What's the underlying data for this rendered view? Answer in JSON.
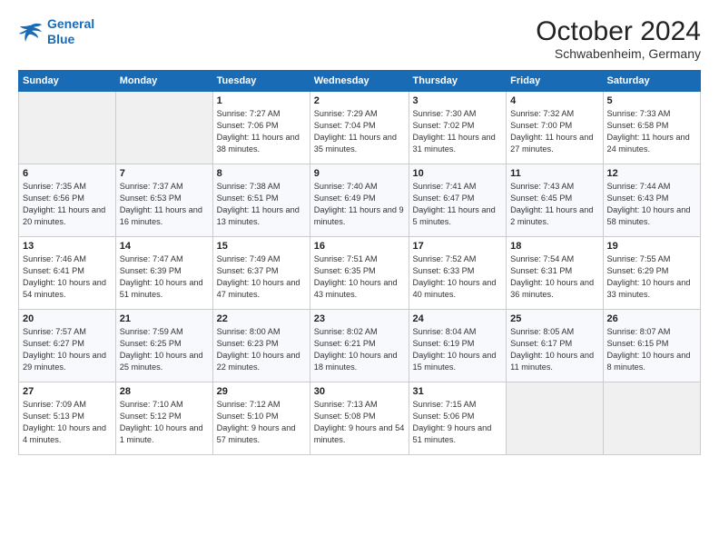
{
  "header": {
    "logo": {
      "line1": "General",
      "line2": "Blue"
    },
    "title": "October 2024",
    "location": "Schwabenheim, Germany"
  },
  "weekdays": [
    "Sunday",
    "Monday",
    "Tuesday",
    "Wednesday",
    "Thursday",
    "Friday",
    "Saturday"
  ],
  "weeks": [
    [
      {
        "day": "",
        "sunrise": "",
        "sunset": "",
        "daylight": "",
        "empty": true
      },
      {
        "day": "",
        "sunrise": "",
        "sunset": "",
        "daylight": "",
        "empty": true
      },
      {
        "day": "1",
        "sunrise": "Sunrise: 7:27 AM",
        "sunset": "Sunset: 7:06 PM",
        "daylight": "Daylight: 11 hours and 38 minutes."
      },
      {
        "day": "2",
        "sunrise": "Sunrise: 7:29 AM",
        "sunset": "Sunset: 7:04 PM",
        "daylight": "Daylight: 11 hours and 35 minutes."
      },
      {
        "day": "3",
        "sunrise": "Sunrise: 7:30 AM",
        "sunset": "Sunset: 7:02 PM",
        "daylight": "Daylight: 11 hours and 31 minutes."
      },
      {
        "day": "4",
        "sunrise": "Sunrise: 7:32 AM",
        "sunset": "Sunset: 7:00 PM",
        "daylight": "Daylight: 11 hours and 27 minutes."
      },
      {
        "day": "5",
        "sunrise": "Sunrise: 7:33 AM",
        "sunset": "Sunset: 6:58 PM",
        "daylight": "Daylight: 11 hours and 24 minutes."
      }
    ],
    [
      {
        "day": "6",
        "sunrise": "Sunrise: 7:35 AM",
        "sunset": "Sunset: 6:56 PM",
        "daylight": "Daylight: 11 hours and 20 minutes."
      },
      {
        "day": "7",
        "sunrise": "Sunrise: 7:37 AM",
        "sunset": "Sunset: 6:53 PM",
        "daylight": "Daylight: 11 hours and 16 minutes."
      },
      {
        "day": "8",
        "sunrise": "Sunrise: 7:38 AM",
        "sunset": "Sunset: 6:51 PM",
        "daylight": "Daylight: 11 hours and 13 minutes."
      },
      {
        "day": "9",
        "sunrise": "Sunrise: 7:40 AM",
        "sunset": "Sunset: 6:49 PM",
        "daylight": "Daylight: 11 hours and 9 minutes."
      },
      {
        "day": "10",
        "sunrise": "Sunrise: 7:41 AM",
        "sunset": "Sunset: 6:47 PM",
        "daylight": "Daylight: 11 hours and 5 minutes."
      },
      {
        "day": "11",
        "sunrise": "Sunrise: 7:43 AM",
        "sunset": "Sunset: 6:45 PM",
        "daylight": "Daylight: 11 hours and 2 minutes."
      },
      {
        "day": "12",
        "sunrise": "Sunrise: 7:44 AM",
        "sunset": "Sunset: 6:43 PM",
        "daylight": "Daylight: 10 hours and 58 minutes."
      }
    ],
    [
      {
        "day": "13",
        "sunrise": "Sunrise: 7:46 AM",
        "sunset": "Sunset: 6:41 PM",
        "daylight": "Daylight: 10 hours and 54 minutes."
      },
      {
        "day": "14",
        "sunrise": "Sunrise: 7:47 AM",
        "sunset": "Sunset: 6:39 PM",
        "daylight": "Daylight: 10 hours and 51 minutes."
      },
      {
        "day": "15",
        "sunrise": "Sunrise: 7:49 AM",
        "sunset": "Sunset: 6:37 PM",
        "daylight": "Daylight: 10 hours and 47 minutes."
      },
      {
        "day": "16",
        "sunrise": "Sunrise: 7:51 AM",
        "sunset": "Sunset: 6:35 PM",
        "daylight": "Daylight: 10 hours and 43 minutes."
      },
      {
        "day": "17",
        "sunrise": "Sunrise: 7:52 AM",
        "sunset": "Sunset: 6:33 PM",
        "daylight": "Daylight: 10 hours and 40 minutes."
      },
      {
        "day": "18",
        "sunrise": "Sunrise: 7:54 AM",
        "sunset": "Sunset: 6:31 PM",
        "daylight": "Daylight: 10 hours and 36 minutes."
      },
      {
        "day": "19",
        "sunrise": "Sunrise: 7:55 AM",
        "sunset": "Sunset: 6:29 PM",
        "daylight": "Daylight: 10 hours and 33 minutes."
      }
    ],
    [
      {
        "day": "20",
        "sunrise": "Sunrise: 7:57 AM",
        "sunset": "Sunset: 6:27 PM",
        "daylight": "Daylight: 10 hours and 29 minutes."
      },
      {
        "day": "21",
        "sunrise": "Sunrise: 7:59 AM",
        "sunset": "Sunset: 6:25 PM",
        "daylight": "Daylight: 10 hours and 25 minutes."
      },
      {
        "day": "22",
        "sunrise": "Sunrise: 8:00 AM",
        "sunset": "Sunset: 6:23 PM",
        "daylight": "Daylight: 10 hours and 22 minutes."
      },
      {
        "day": "23",
        "sunrise": "Sunrise: 8:02 AM",
        "sunset": "Sunset: 6:21 PM",
        "daylight": "Daylight: 10 hours and 18 minutes."
      },
      {
        "day": "24",
        "sunrise": "Sunrise: 8:04 AM",
        "sunset": "Sunset: 6:19 PM",
        "daylight": "Daylight: 10 hours and 15 minutes."
      },
      {
        "day": "25",
        "sunrise": "Sunrise: 8:05 AM",
        "sunset": "Sunset: 6:17 PM",
        "daylight": "Daylight: 10 hours and 11 minutes."
      },
      {
        "day": "26",
        "sunrise": "Sunrise: 8:07 AM",
        "sunset": "Sunset: 6:15 PM",
        "daylight": "Daylight: 10 hours and 8 minutes."
      }
    ],
    [
      {
        "day": "27",
        "sunrise": "Sunrise: 7:09 AM",
        "sunset": "Sunset: 5:13 PM",
        "daylight": "Daylight: 10 hours and 4 minutes."
      },
      {
        "day": "28",
        "sunrise": "Sunrise: 7:10 AM",
        "sunset": "Sunset: 5:12 PM",
        "daylight": "Daylight: 10 hours and 1 minute."
      },
      {
        "day": "29",
        "sunrise": "Sunrise: 7:12 AM",
        "sunset": "Sunset: 5:10 PM",
        "daylight": "Daylight: 9 hours and 57 minutes."
      },
      {
        "day": "30",
        "sunrise": "Sunrise: 7:13 AM",
        "sunset": "Sunset: 5:08 PM",
        "daylight": "Daylight: 9 hours and 54 minutes."
      },
      {
        "day": "31",
        "sunrise": "Sunrise: 7:15 AM",
        "sunset": "Sunset: 5:06 PM",
        "daylight": "Daylight: 9 hours and 51 minutes."
      },
      {
        "day": "",
        "sunrise": "",
        "sunset": "",
        "daylight": "",
        "empty": true
      },
      {
        "day": "",
        "sunrise": "",
        "sunset": "",
        "daylight": "",
        "empty": true
      }
    ]
  ]
}
